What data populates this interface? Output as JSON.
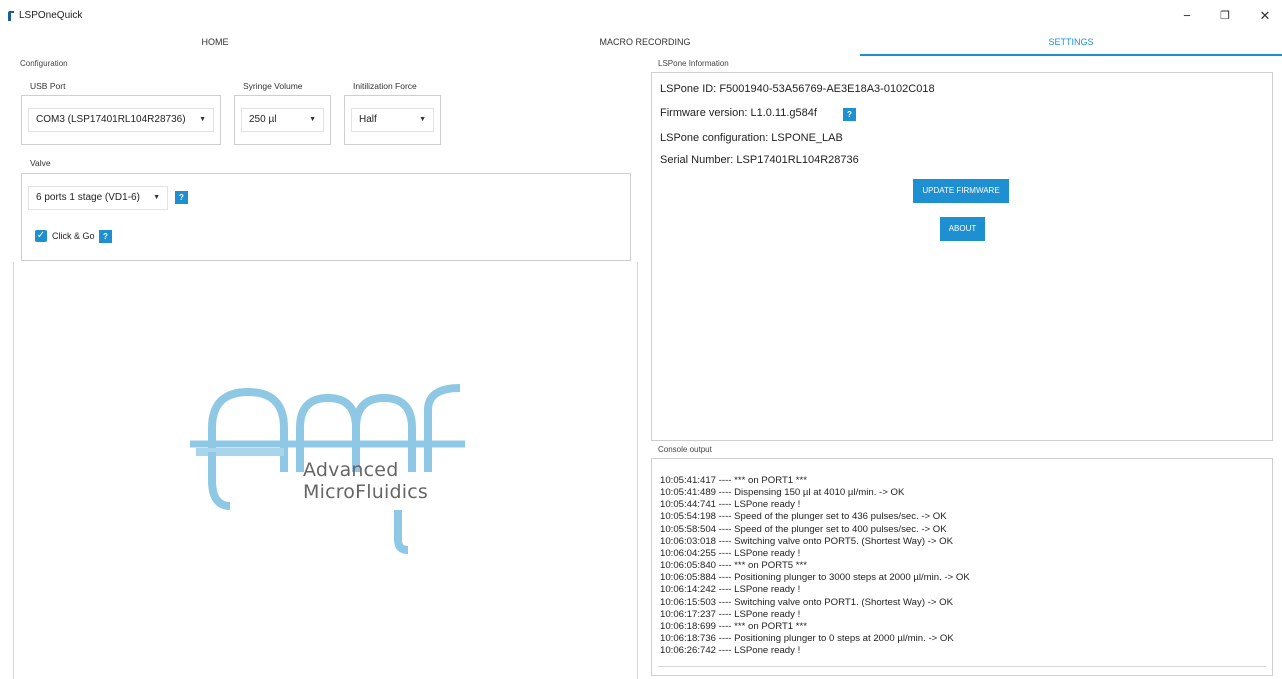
{
  "window": {
    "title": "LSPOneQuick",
    "minimize": "−",
    "maximize": "❐",
    "close": "✕"
  },
  "tabs": [
    {
      "label": "HOME"
    },
    {
      "label": "MACRO RECORDING"
    },
    {
      "label": "SETTINGS"
    }
  ],
  "configuration": {
    "title": "Configuration",
    "usb_port": {
      "label": "USB Port",
      "value": "COM3 (LSP17401RL104R28736)"
    },
    "syringe_volume": {
      "label": "Syringe Volume",
      "value": "250 µl"
    },
    "init_force": {
      "label": "Initilization Force",
      "value": "Half"
    },
    "valve": {
      "label": "Valve",
      "value": "6 ports 1 stage (VD1-6)"
    },
    "click_go": {
      "label": "Click & Go",
      "checked": true
    },
    "help_glyph": "?"
  },
  "logo": {
    "line1": "Advanced",
    "line2": "MicroFluidics",
    "color": "#8ec8e4"
  },
  "lspone_info": {
    "title": "LSPone Information",
    "id": "LSPone ID: F5001940-53A56769-AE3E18A3-0102C018",
    "firmware": "Firmware version: L1.0.11.g584f",
    "configuration": "LSPone configuration: LSPONE_LAB",
    "serial": "Serial Number: LSP17401RL104R28736",
    "update_button": "UPDATE FIRMWARE",
    "about_button": "ABOUT"
  },
  "console": {
    "title": "Console output",
    "lines": [
      "10:05:41:417 ---- *** on PORT1 ***",
      "10:05:41:489 ---- Dispensing 150 µl at 4010 µl/min. -> OK",
      "10:05:44:741 ---- LSPone ready !",
      "10:05:54:198 ---- Speed of the plunger set to 436 pulses/sec. -> OK",
      "10:05:58:504 ---- Speed of the plunger set to 400 pulses/sec. -> OK",
      "10:06:03:018 ---- Switching valve onto PORT5. (Shortest Way) -> OK",
      "10:06:04:255 ---- LSPone ready !",
      "10:06:05:840 ---- *** on PORT5 ***",
      "10:06:05:884 ---- Positioning plunger to 3000 steps at 2000 µl/min. -> OK",
      "10:06:14:242 ---- LSPone ready !",
      "10:06:15:503 ---- Switching valve onto PORT1. (Shortest Way) -> OK",
      "10:06:17:237 ---- LSPone ready !",
      "10:06:18:699 ---- *** on PORT1 ***",
      "10:06:18:736 ---- Positioning plunger to 0 steps at 2000 µl/min. -> OK",
      "10:06:26:742 ---- LSPone ready !"
    ]
  },
  "colors": {
    "accent": "#1e8fd0"
  }
}
